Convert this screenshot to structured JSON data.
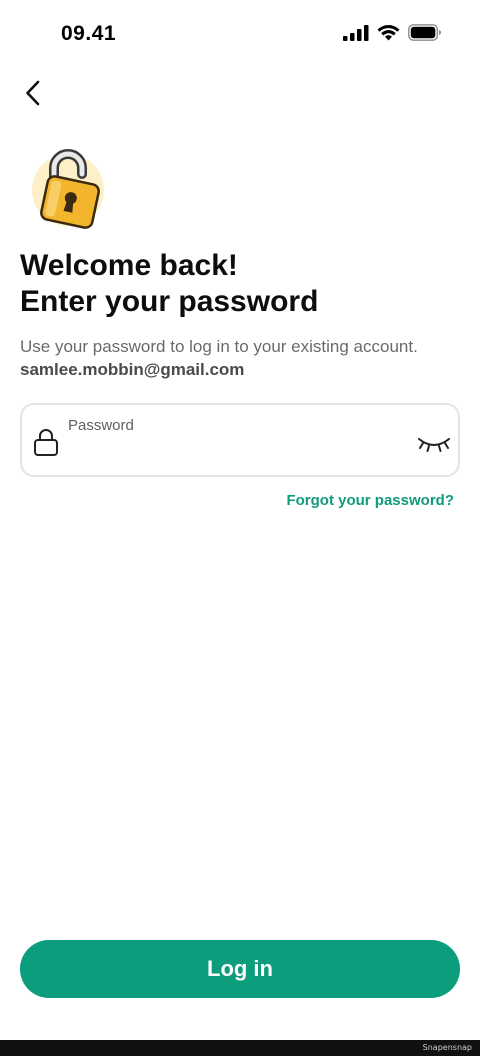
{
  "status_bar": {
    "time": "09.41"
  },
  "header": {
    "back_icon": "chevron-left-icon"
  },
  "hero": {
    "icon": "padlock-illustration",
    "title_line1": "Welcome back!",
    "title_line2": "Enter your password",
    "subtitle": "Use your password to log in to your existing account.",
    "email": "samlee.mobbin@gmail.com"
  },
  "password_field": {
    "label": "Password",
    "value": "",
    "leading_icon": "lock-icon",
    "trailing_icon": "eye-closed-icon"
  },
  "forgot_password": {
    "label": "Forgot your password?"
  },
  "actions": {
    "login_label": "Log in"
  },
  "footer": {
    "watermark": "Snapensnap"
  },
  "colors": {
    "accent": "#0c9d7d",
    "link": "#119a7c",
    "text_primary": "#0d0d0d",
    "text_secondary": "#6a6a6a",
    "field_border": "#e4e4e4"
  }
}
